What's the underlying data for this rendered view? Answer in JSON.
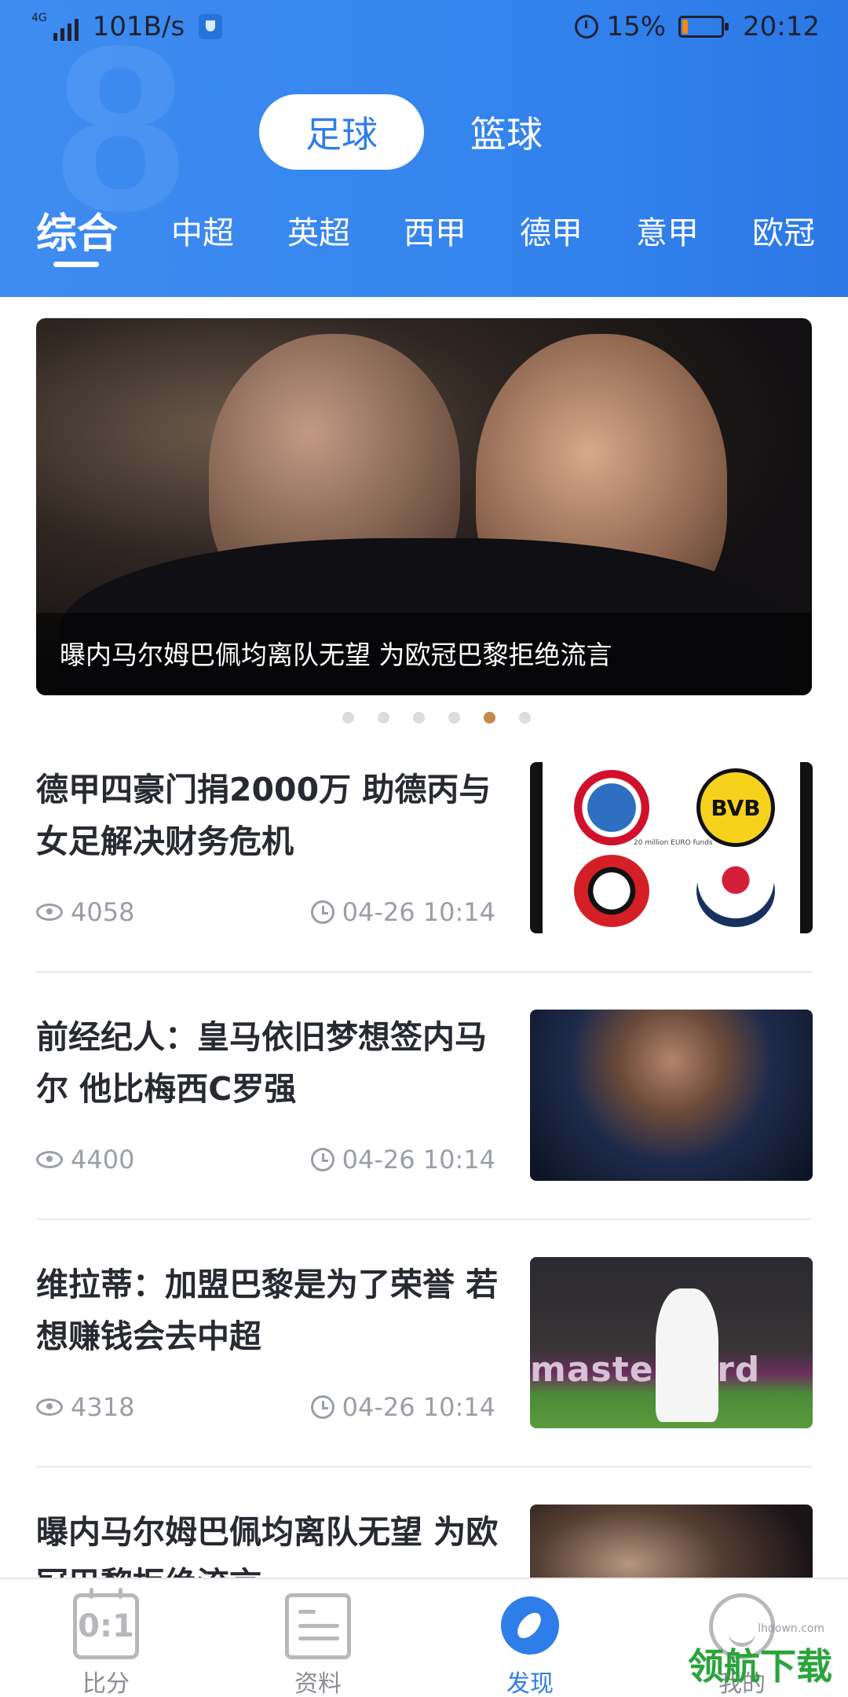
{
  "status_bar": {
    "network": "4G",
    "speed": "101B/s",
    "battery_percent": "15%",
    "battery_level": 0.15,
    "time": "20:12"
  },
  "sport_tabs": [
    {
      "label": "足球",
      "active": true
    },
    {
      "label": "篮球",
      "active": false
    }
  ],
  "league_tabs": [
    "综合",
    "中超",
    "英超",
    "西甲",
    "德甲",
    "意甲",
    "欧冠"
  ],
  "banner": {
    "caption": "曝内马尔姆巴佩均离队无望 为欧冠巴黎拒绝流言",
    "page_count": 6,
    "active_page": 5
  },
  "news": [
    {
      "title": "德甲四豪门捐2000万 助德丙与女足解决财务危机",
      "views": "4058",
      "time": "04-26 10:14"
    },
    {
      "title": "前经纪人：皇马依旧梦想签内马尔 他比梅西C罗强",
      "views": "4400",
      "time": "04-26 10:14"
    },
    {
      "title": "维拉蒂：加盟巴黎是为了荣誉 若想赚钱会去中超",
      "views": "4318",
      "time": "04-26 10:14"
    },
    {
      "title": "曝内马尔姆巴佩均离队无望 为欧冠巴黎拒绝流言",
      "views": "",
      "time": ""
    }
  ],
  "thumb_texts": {
    "logos_caption": "20 million EURO funds",
    "photo2_banner": "mastercard"
  },
  "bottom_nav": [
    {
      "label": "比分",
      "icon": "scoreboard-icon",
      "active": false,
      "glyph": "0:1"
    },
    {
      "label": "资料",
      "icon": "profile-card-icon",
      "active": false
    },
    {
      "label": "发现",
      "icon": "compass-icon",
      "active": true
    },
    {
      "label": "我的",
      "icon": "face-icon",
      "active": false
    }
  ],
  "watermark": {
    "text": "领航下载",
    "url": "lhdown.com"
  },
  "colors": {
    "accent": "#2f7de8",
    "active_dot": "#c18c4b",
    "meta_text": "#9a9ea6"
  }
}
